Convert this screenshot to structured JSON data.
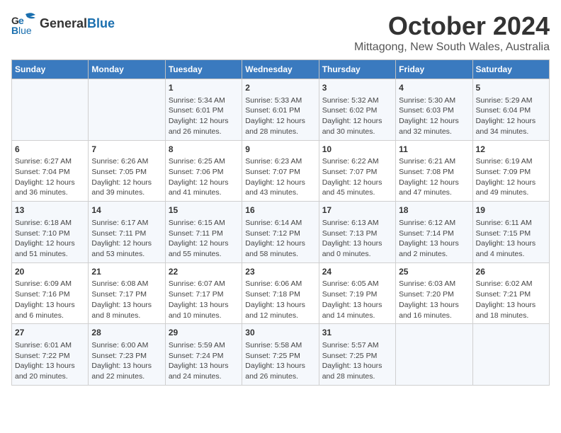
{
  "header": {
    "logo_line1": "General",
    "logo_line2": "Blue",
    "title": "October 2024",
    "subtitle": "Mittagong, New South Wales, Australia"
  },
  "columns": [
    "Sunday",
    "Monday",
    "Tuesday",
    "Wednesday",
    "Thursday",
    "Friday",
    "Saturday"
  ],
  "weeks": [
    [
      {
        "day": "",
        "content": ""
      },
      {
        "day": "",
        "content": ""
      },
      {
        "day": "1",
        "content": "Sunrise: 5:34 AM\nSunset: 6:01 PM\nDaylight: 12 hours\nand 26 minutes."
      },
      {
        "day": "2",
        "content": "Sunrise: 5:33 AM\nSunset: 6:01 PM\nDaylight: 12 hours\nand 28 minutes."
      },
      {
        "day": "3",
        "content": "Sunrise: 5:32 AM\nSunset: 6:02 PM\nDaylight: 12 hours\nand 30 minutes."
      },
      {
        "day": "4",
        "content": "Sunrise: 5:30 AM\nSunset: 6:03 PM\nDaylight: 12 hours\nand 32 minutes."
      },
      {
        "day": "5",
        "content": "Sunrise: 5:29 AM\nSunset: 6:04 PM\nDaylight: 12 hours\nand 34 minutes."
      }
    ],
    [
      {
        "day": "6",
        "content": "Sunrise: 6:27 AM\nSunset: 7:04 PM\nDaylight: 12 hours\nand 36 minutes."
      },
      {
        "day": "7",
        "content": "Sunrise: 6:26 AM\nSunset: 7:05 PM\nDaylight: 12 hours\nand 39 minutes."
      },
      {
        "day": "8",
        "content": "Sunrise: 6:25 AM\nSunset: 7:06 PM\nDaylight: 12 hours\nand 41 minutes."
      },
      {
        "day": "9",
        "content": "Sunrise: 6:23 AM\nSunset: 7:07 PM\nDaylight: 12 hours\nand 43 minutes."
      },
      {
        "day": "10",
        "content": "Sunrise: 6:22 AM\nSunset: 7:07 PM\nDaylight: 12 hours\nand 45 minutes."
      },
      {
        "day": "11",
        "content": "Sunrise: 6:21 AM\nSunset: 7:08 PM\nDaylight: 12 hours\nand 47 minutes."
      },
      {
        "day": "12",
        "content": "Sunrise: 6:19 AM\nSunset: 7:09 PM\nDaylight: 12 hours\nand 49 minutes."
      }
    ],
    [
      {
        "day": "13",
        "content": "Sunrise: 6:18 AM\nSunset: 7:10 PM\nDaylight: 12 hours\nand 51 minutes."
      },
      {
        "day": "14",
        "content": "Sunrise: 6:17 AM\nSunset: 7:11 PM\nDaylight: 12 hours\nand 53 minutes."
      },
      {
        "day": "15",
        "content": "Sunrise: 6:15 AM\nSunset: 7:11 PM\nDaylight: 12 hours\nand 55 minutes."
      },
      {
        "day": "16",
        "content": "Sunrise: 6:14 AM\nSunset: 7:12 PM\nDaylight: 12 hours\nand 58 minutes."
      },
      {
        "day": "17",
        "content": "Sunrise: 6:13 AM\nSunset: 7:13 PM\nDaylight: 13 hours\nand 0 minutes."
      },
      {
        "day": "18",
        "content": "Sunrise: 6:12 AM\nSunset: 7:14 PM\nDaylight: 13 hours\nand 2 minutes."
      },
      {
        "day": "19",
        "content": "Sunrise: 6:11 AM\nSunset: 7:15 PM\nDaylight: 13 hours\nand 4 minutes."
      }
    ],
    [
      {
        "day": "20",
        "content": "Sunrise: 6:09 AM\nSunset: 7:16 PM\nDaylight: 13 hours\nand 6 minutes."
      },
      {
        "day": "21",
        "content": "Sunrise: 6:08 AM\nSunset: 7:17 PM\nDaylight: 13 hours\nand 8 minutes."
      },
      {
        "day": "22",
        "content": "Sunrise: 6:07 AM\nSunset: 7:17 PM\nDaylight: 13 hours\nand 10 minutes."
      },
      {
        "day": "23",
        "content": "Sunrise: 6:06 AM\nSunset: 7:18 PM\nDaylight: 13 hours\nand 12 minutes."
      },
      {
        "day": "24",
        "content": "Sunrise: 6:05 AM\nSunset: 7:19 PM\nDaylight: 13 hours\nand 14 minutes."
      },
      {
        "day": "25",
        "content": "Sunrise: 6:03 AM\nSunset: 7:20 PM\nDaylight: 13 hours\nand 16 minutes."
      },
      {
        "day": "26",
        "content": "Sunrise: 6:02 AM\nSunset: 7:21 PM\nDaylight: 13 hours\nand 18 minutes."
      }
    ],
    [
      {
        "day": "27",
        "content": "Sunrise: 6:01 AM\nSunset: 7:22 PM\nDaylight: 13 hours\nand 20 minutes."
      },
      {
        "day": "28",
        "content": "Sunrise: 6:00 AM\nSunset: 7:23 PM\nDaylight: 13 hours\nand 22 minutes."
      },
      {
        "day": "29",
        "content": "Sunrise: 5:59 AM\nSunset: 7:24 PM\nDaylight: 13 hours\nand 24 minutes."
      },
      {
        "day": "30",
        "content": "Sunrise: 5:58 AM\nSunset: 7:25 PM\nDaylight: 13 hours\nand 26 minutes."
      },
      {
        "day": "31",
        "content": "Sunrise: 5:57 AM\nSunset: 7:25 PM\nDaylight: 13 hours\nand 28 minutes."
      },
      {
        "day": "",
        "content": ""
      },
      {
        "day": "",
        "content": ""
      }
    ]
  ]
}
